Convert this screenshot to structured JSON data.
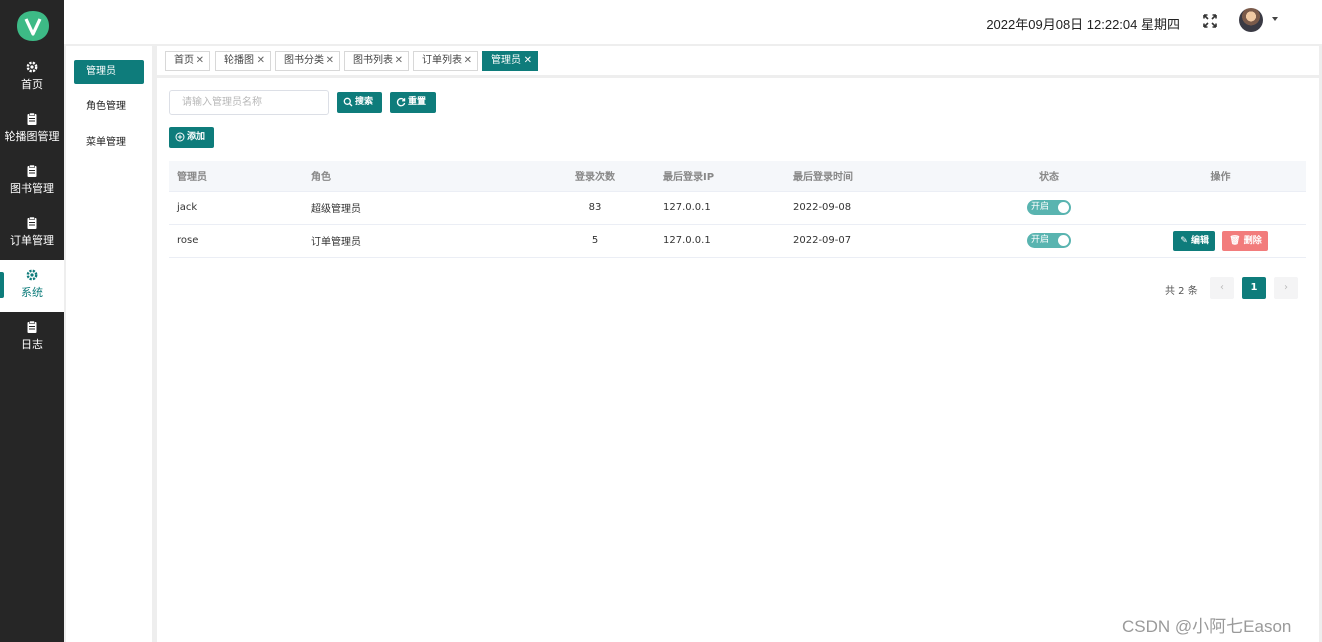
{
  "colors": {
    "accent": "#0e7c7b",
    "danger": "#f27c7c",
    "sidebar": "#262626"
  },
  "sidebar": {
    "logo": "V",
    "items": [
      {
        "label": "首页",
        "icon": "gear-icon"
      },
      {
        "label": "轮播图管理",
        "icon": "clipboard-icon"
      },
      {
        "label": "图书管理",
        "icon": "clipboard-icon"
      },
      {
        "label": "订单管理",
        "icon": "clipboard-icon"
      },
      {
        "label": "系统",
        "icon": "gear-icon",
        "active": true
      },
      {
        "label": "日志",
        "icon": "clipboard-icon"
      }
    ]
  },
  "header": {
    "datetime": "2022年09月08日 12:22:04 星期四",
    "fullscreen_icon": "fullscreen-icon",
    "avatar_icon": "avatar"
  },
  "submenu": {
    "items": [
      {
        "label": "管理员",
        "active": true
      },
      {
        "label": "角色管理"
      },
      {
        "label": "菜单管理"
      }
    ]
  },
  "tabs": [
    {
      "label": "首页"
    },
    {
      "label": "轮播图"
    },
    {
      "label": "图书分类"
    },
    {
      "label": "图书列表"
    },
    {
      "label": "订单列表"
    },
    {
      "label": "管理员",
      "active": true
    }
  ],
  "toolbar": {
    "search_placeholder": "请输入管理员名称",
    "search_label": "搜索",
    "reset_label": "重置",
    "add_label": "添加"
  },
  "table": {
    "columns": [
      "管理员",
      "角色",
      "登录次数",
      "最后登录IP",
      "最后登录时间",
      "状态",
      "操作"
    ],
    "rows": [
      {
        "name": "jack",
        "role": "超级管理员",
        "logins": "83",
        "ip": "127.0.0.1",
        "last_time": "2022-09-08",
        "status": "开启",
        "actions": false
      },
      {
        "name": "rose",
        "role": "订单管理员",
        "logins": "5",
        "ip": "127.0.0.1",
        "last_time": "2022-09-07",
        "status": "开启",
        "actions": true
      }
    ],
    "edit_label": "编辑",
    "delete_label": "删除"
  },
  "pagination": {
    "total_text": "共 2 条",
    "current_page": "1",
    "prev": "‹",
    "next": "›"
  },
  "watermark": "CSDN @小阿七Eason"
}
